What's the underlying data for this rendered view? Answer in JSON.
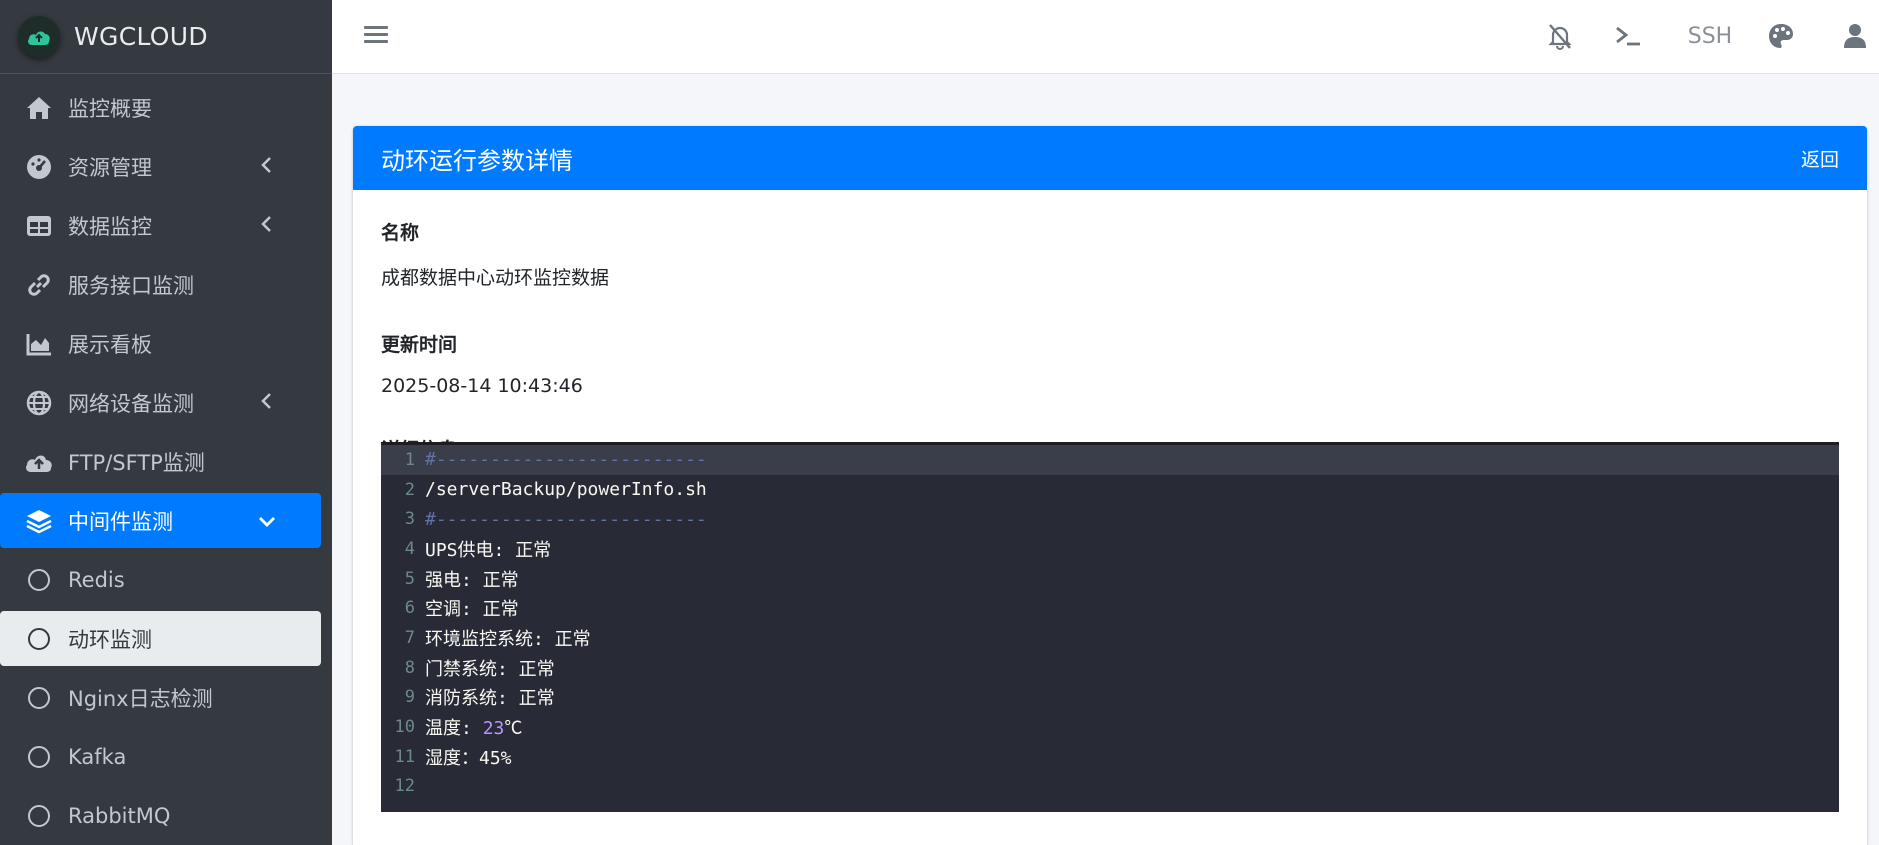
{
  "brand": {
    "name": "WGCLOUD"
  },
  "sidebar": {
    "items": [
      {
        "label": "监控概要",
        "icon": "home-icon",
        "has_arrow": false
      },
      {
        "label": "资源管理",
        "icon": "dashboard-gauge-icon",
        "has_arrow": true
      },
      {
        "label": "数据监控",
        "icon": "table-icon",
        "has_arrow": true
      },
      {
        "label": "服务接口监测",
        "icon": "link-icon",
        "has_arrow": false
      },
      {
        "label": "展示看板",
        "icon": "area-chart-icon",
        "has_arrow": false
      },
      {
        "label": "网络设备监测",
        "icon": "globe-icon",
        "has_arrow": true
      },
      {
        "label": "FTP/SFTP监测",
        "icon": "cloud-upload-icon",
        "has_arrow": false
      },
      {
        "label": "中间件监测",
        "icon": "layers-icon",
        "has_arrow": true,
        "expanded": true,
        "active": true
      }
    ],
    "subitems": [
      {
        "label": "Redis"
      },
      {
        "label": "动环监测",
        "active": true
      },
      {
        "label": "Nginx日志检测"
      },
      {
        "label": "Kafka"
      },
      {
        "label": "RabbitMQ"
      }
    ]
  },
  "header": {
    "ssh_label": "SSH",
    "icons": [
      "hamburger-menu-icon",
      "bell-slash-icon",
      "terminal-icon",
      "palette-icon",
      "user-icon"
    ]
  },
  "card": {
    "title": "动环运行参数详情",
    "back_label": "返回",
    "name_label": "名称",
    "name_value": "成都数据中心动环监控数据",
    "time_label": "更新时间",
    "time_value": "2025-08-14 10:43:46",
    "detail_label": "详细信息"
  },
  "editor": {
    "lines": [
      {
        "n": "1",
        "text": "#-------------------------",
        "kind": "comment",
        "current": true
      },
      {
        "n": "2",
        "text": "/serverBackup/powerInfo.sh",
        "kind": "plain"
      },
      {
        "n": "3",
        "text": "#-------------------------",
        "kind": "comment"
      },
      {
        "n": "4",
        "text": "UPS供电: 正常",
        "kind": "plain"
      },
      {
        "n": "5",
        "text": "强电: 正常",
        "kind": "plain"
      },
      {
        "n": "6",
        "text": "空调: 正常",
        "kind": "plain"
      },
      {
        "n": "7",
        "text": "环境监控系统: 正常",
        "kind": "plain"
      },
      {
        "n": "8",
        "text": "门禁系统: 正常",
        "kind": "plain"
      },
      {
        "n": "9",
        "text": "消防系统: 正常",
        "kind": "plain"
      },
      {
        "n": "10",
        "text_before": "温度: ",
        "number": "23",
        "text_after": "℃",
        "kind": "number"
      },
      {
        "n": "11",
        "text": "湿度：45%",
        "kind": "plain"
      },
      {
        "n": "12",
        "text": "",
        "kind": "plain"
      }
    ]
  },
  "colors": {
    "sidebar_bg": "#343a40",
    "accent": "#007bff",
    "editor_bg": "#282a36",
    "comment": "#6272a4",
    "number": "#bd93f9"
  }
}
